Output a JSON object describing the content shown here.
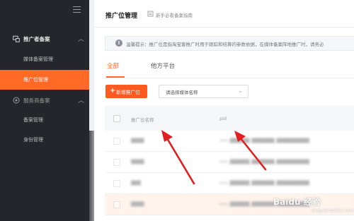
{
  "sidebar": {
    "groups": [
      {
        "label": "推广者备案",
        "icon": "promoter-icon",
        "expanded": true
      },
      {
        "label": "服务商备案",
        "icon": "service-provider-icon",
        "expanded": true
      }
    ],
    "items": [
      {
        "label": "媒体备案管理",
        "active": false
      },
      {
        "label": "推广位管理",
        "active": true
      },
      {
        "label": "备案管理",
        "active": false
      },
      {
        "label": "身份管理",
        "active": false
      }
    ],
    "accent_color": "#ff6a26"
  },
  "header": {
    "title": "推广位管理",
    "guide_link": "新手必看备案指南"
  },
  "notice": {
    "text": "温馨提示：推广位是指淘宝客推广时用于跟踪和结算的参数依据，在媒体备案阵地推广时，请务必"
  },
  "tabs": [
    {
      "label": "全部",
      "active": true
    },
    {
      "label": "他方平台",
      "active": false
    }
  ],
  "toolbar": {
    "add_button": "新增推广位",
    "media_select_placeholder": "请选择媒体名称"
  },
  "table": {
    "columns": [
      "推广位名称",
      "pid"
    ],
    "rows": [
      {
        "name": "████",
        "pid": "mm_██████_███████_██████████"
      },
      {
        "name": "████",
        "pid": "mm_██████_███████_██████████"
      },
      {
        "name": "███",
        "pid": "mm_██████_███████_██████████"
      },
      {
        "name": "████",
        "pid": "mm_██████_███████_██████████"
      }
    ]
  },
  "watermark": {
    "text": "Baidu 经验",
    "sub": "jingyan.baidu.com"
  },
  "annotation_color": "#e02020"
}
